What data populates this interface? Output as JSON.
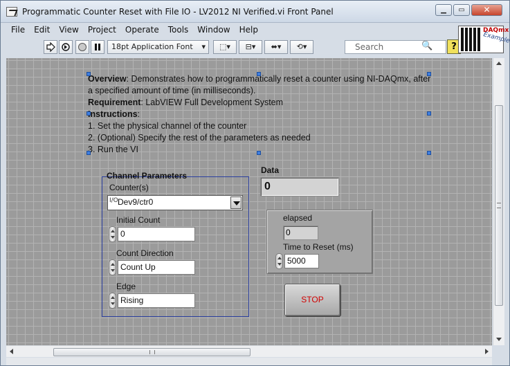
{
  "window": {
    "title": "Programmatic Counter Reset with File IO - LV2012 NI Verified.vi Front Panel",
    "minimize_glyph": "▁",
    "restore_glyph": "▭",
    "close_glyph": "✕"
  },
  "menubar": {
    "items": [
      "File",
      "Edit",
      "View",
      "Project",
      "Operate",
      "Tools",
      "Window",
      "Help"
    ]
  },
  "toolbar": {
    "run_icon": "run-arrow-icon",
    "run_continuous_icon": "run-continuously-icon",
    "abort_icon": "abort-icon",
    "pause_icon": "pause-icon",
    "font_label": "18pt Application Font",
    "font_drop_glyph": "▾",
    "align_glyph": "⬚▾",
    "distribute_glyph": "⊟▾",
    "resize_glyph": "⬌▾",
    "reorder_glyph": "⟲▾",
    "search_placeholder": "Search",
    "search_icon_glyph": "🔍",
    "help_glyph": "?"
  },
  "logo": {
    "daqmx": "DAQmx",
    "example": "Example"
  },
  "front_panel": {
    "overview_label": "Overview",
    "overview_text": ": Demonstrates how to programmatically reset a counter using NI-DAQmx, after a specified amount of time (in milliseconds).",
    "requirement_label": "Requirement",
    "requirement_text": ": LabVIEW Full Development System",
    "instructions_label": "Instructions",
    "instructions_colon": ":",
    "instructions": [
      "1. Set the physical channel of the counter",
      "2. (Optional) Specify the rest of the parameters as needed",
      "3. Run the VI"
    ],
    "channel_group_label": "Channel Parameters",
    "counter_label": "Counter(s)",
    "io_icon": "I/O",
    "counter_value": "Dev9/ctr0",
    "initial_count_label": "Initial Count",
    "initial_count_value": "0",
    "count_direction_label": "Count Direction",
    "count_direction_value": "Count Up",
    "edge_label": "Edge",
    "edge_value": "Rising",
    "data_label": "Data",
    "data_value": "0",
    "elapsed_label": "elapsed",
    "elapsed_value": "0",
    "time_to_reset_label": "Time to Reset (ms)",
    "time_to_reset_value": "5000",
    "stop_label": "STOP"
  },
  "colors": {
    "panel_grid": "#9b9b9b",
    "stop_text": "#d10000",
    "group_border": "#2b3fa0"
  }
}
